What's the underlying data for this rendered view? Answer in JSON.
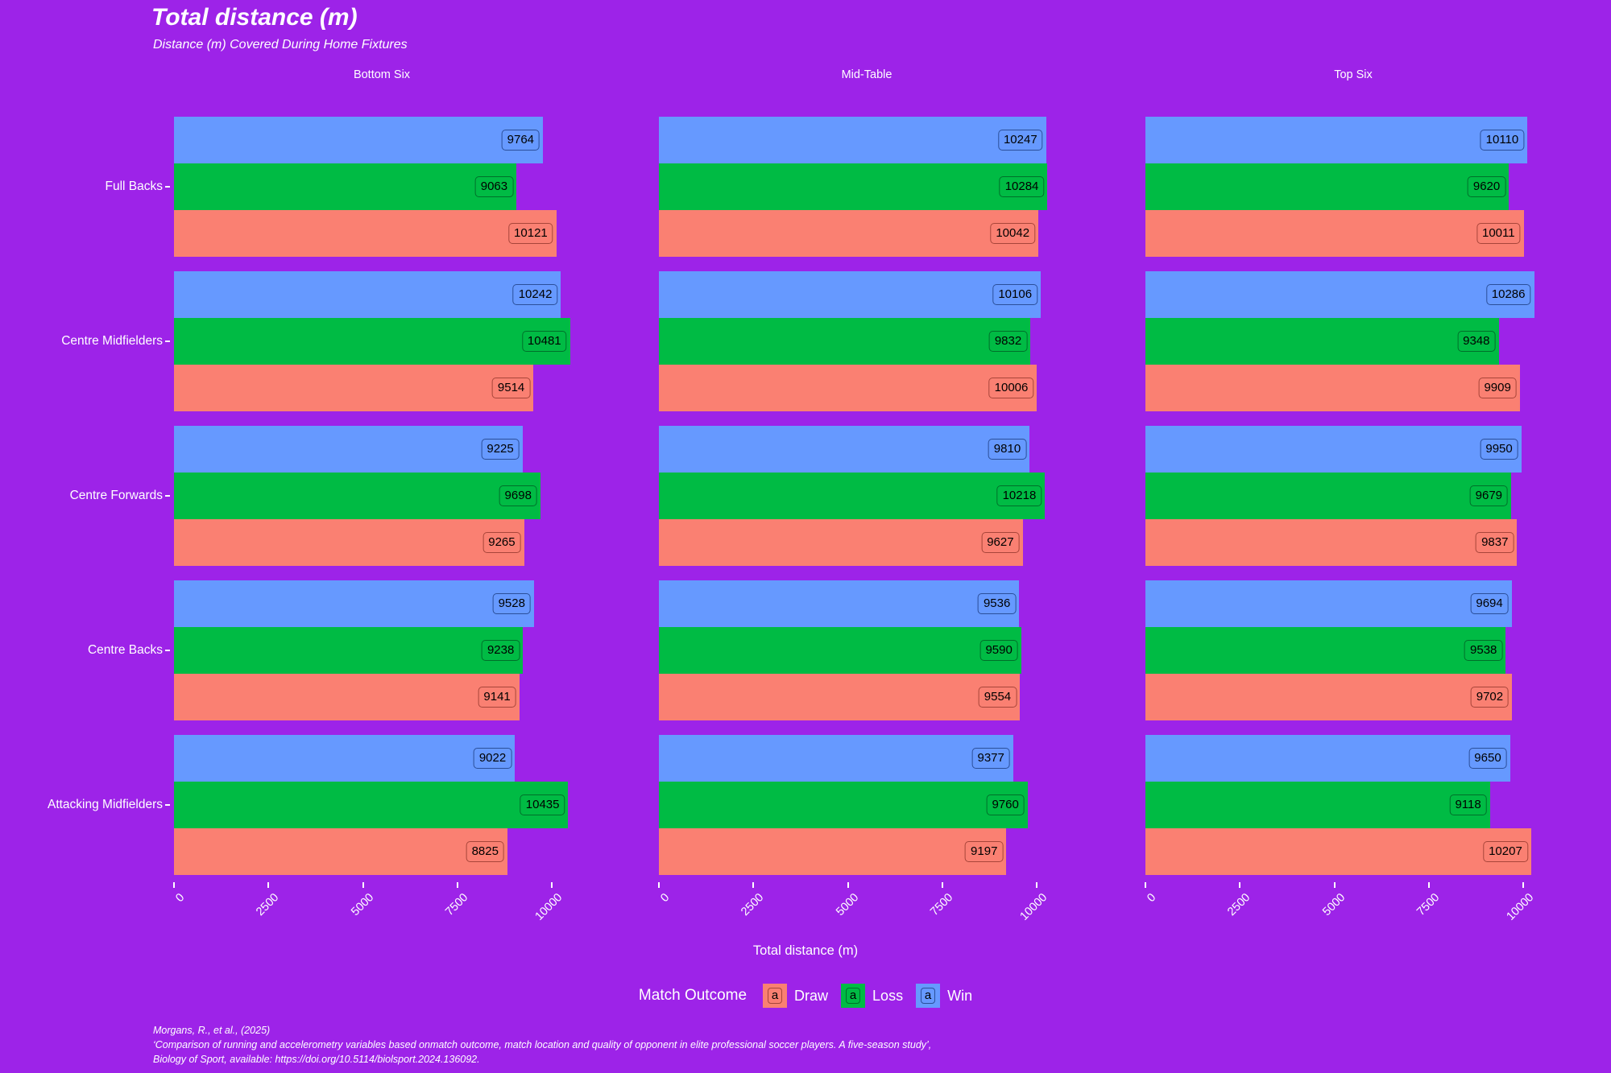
{
  "title": "Total distance (m)",
  "subtitle": "Distance (m) Covered During Home Fixtures",
  "xaxis_title": "Total distance (m)",
  "legend": {
    "title": "Match Outcome",
    "glyph": "a",
    "items": [
      {
        "label": "Draw",
        "key": "draw",
        "color": "#fa8072"
      },
      {
        "label": "Loss",
        "key": "loss",
        "color": "#00bb44"
      },
      {
        "label": "Win",
        "key": "win",
        "color": "#6699ff"
      }
    ]
  },
  "caption": [
    "Morgans, R., et al., (2025)",
    "‘Comparison of running and accelerometry variables based onmatch outcome, match location and quality of opponent in elite professional soccer players. A five-season study’,",
    "Biology of Sport, available: https://doi.org/10.5114/biolsport.2024.136092."
  ],
  "colors": {
    "background": "#9d23e8",
    "win": "#6699ff",
    "loss": "#00bb44",
    "draw": "#fa8072",
    "text": "#ffffff"
  },
  "chart_data": {
    "type": "bar",
    "title": "Total distance (m)",
    "subtitle": "Distance (m) Covered During Home Fixtures",
    "xlabel": "Total distance (m)",
    "ylabel": "",
    "orientation": "horizontal",
    "grid": false,
    "legend_position": "bottom",
    "xlim": [
      0,
      11000
    ],
    "xticks": [
      0,
      2500,
      5000,
      7500,
      10000
    ],
    "xticklabels": [
      "0",
      "2500",
      "5000",
      "7500",
      "10000"
    ],
    "facet_columns": [
      "Bottom Six",
      "Mid-Table",
      "Top Six"
    ],
    "categories": [
      "Full Backs",
      "Centre Midfielders",
      "Centre Forwards",
      "Centre Backs",
      "Attacking Midfielders"
    ],
    "series": [
      {
        "name": "Win",
        "color": "#6699ff"
      },
      {
        "name": "Loss",
        "color": "#00bb44"
      },
      {
        "name": "Draw",
        "color": "#fa8072"
      }
    ],
    "panels": [
      {
        "facet": "Bottom Six",
        "rows": [
          {
            "category": "Full Backs",
            "Win": 9764,
            "Loss": 9063,
            "Draw": 10121
          },
          {
            "category": "Centre Midfielders",
            "Win": 10242,
            "Loss": 10481,
            "Draw": 9514
          },
          {
            "category": "Centre Forwards",
            "Win": 9225,
            "Loss": 9698,
            "Draw": 9265
          },
          {
            "category": "Centre Backs",
            "Win": 9528,
            "Loss": 9238,
            "Draw": 9141
          },
          {
            "category": "Attacking Midfielders",
            "Win": 9022,
            "Loss": 10435,
            "Draw": 8825
          }
        ]
      },
      {
        "facet": "Mid-Table",
        "rows": [
          {
            "category": "Full Backs",
            "Win": 10247,
            "Loss": 10284,
            "Draw": 10042
          },
          {
            "category": "Centre Midfielders",
            "Win": 10106,
            "Loss": 9832,
            "Draw": 10006
          },
          {
            "category": "Centre Forwards",
            "Win": 9810,
            "Loss": 10218,
            "Draw": 9627
          },
          {
            "category": "Centre Backs",
            "Win": 9536,
            "Loss": 9590,
            "Draw": 9554
          },
          {
            "category": "Attacking Midfielders",
            "Win": 9377,
            "Loss": 9760,
            "Draw": 9197
          }
        ]
      },
      {
        "facet": "Top Six",
        "rows": [
          {
            "category": "Full Backs",
            "Win": 10110,
            "Loss": 9620,
            "Draw": 10011
          },
          {
            "category": "Centre Midfielders",
            "Win": 10286,
            "Loss": 9348,
            "Draw": 9909
          },
          {
            "category": "Centre Forwards",
            "Win": 9950,
            "Loss": 9679,
            "Draw": 9837
          },
          {
            "category": "Centre Backs",
            "Win": 9694,
            "Loss": 9538,
            "Draw": 9702
          },
          {
            "category": "Attacking Midfielders",
            "Win": 9650,
            "Loss": 9118,
            "Draw": 10207
          }
        ]
      }
    ]
  }
}
